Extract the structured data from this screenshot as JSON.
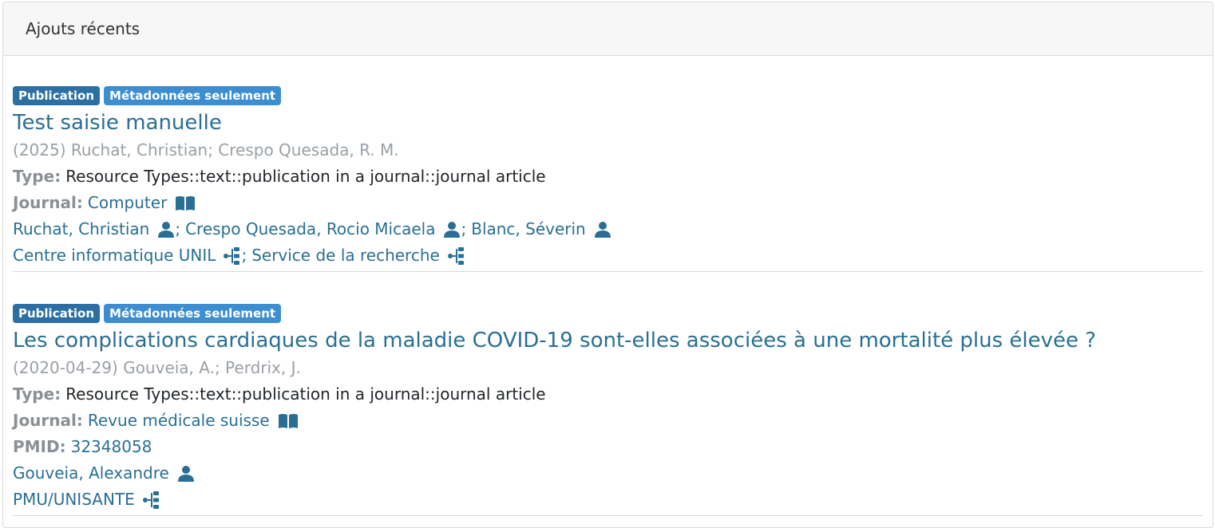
{
  "header": {
    "title": "Ajouts récents"
  },
  "items": [
    {
      "badges": [
        "Publication",
        "Métadonnées seulement"
      ],
      "title": "Test saisie manuelle",
      "meta": "(2025) Ruchat, Christian; Crespo Quesada, R. M.",
      "type_label": "Type:",
      "type_value": "Resource Types::text::publication in a journal::journal article",
      "journal_label": "Journal:",
      "journal_value": "Computer",
      "people": [
        "Ruchat, Christian",
        "Crespo Quesada, Rocio Micaela",
        "Blanc, Séverin"
      ],
      "units": [
        "Centre informatique UNIL",
        "Service de la recherche"
      ]
    },
    {
      "badges": [
        "Publication",
        "Métadonnées seulement"
      ],
      "title": "Les complications cardiaques de la maladie COVID-19 sont-elles associées à une mortalité plus élevée ?",
      "meta": "(2020-04-29) Gouveia, A.; Perdrix, J.",
      "type_label": "Type:",
      "type_value": "Resource Types::text::publication in a journal::journal article",
      "journal_label": "Journal:",
      "journal_value": "Revue médicale suisse",
      "pmid_label": "PMID:",
      "pmid_value": "32348058",
      "people": [
        "Gouveia, Alexandre"
      ],
      "units": [
        "PMU/UNISANTE"
      ]
    }
  ],
  "icons": {
    "journal": "book-open-icon",
    "person": "user-icon",
    "unit": "org-chart-icon"
  },
  "colors": {
    "link": "#2a6f93",
    "badge_publication": "#2c6fa3",
    "badge_metadata": "#3d8ed0"
  }
}
